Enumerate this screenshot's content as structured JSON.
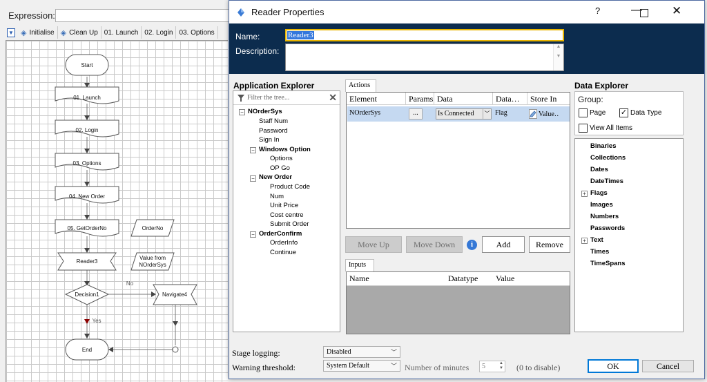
{
  "background": {
    "expression_label": "Expression:",
    "toolbar": {
      "items": [
        "Initialise",
        "Clean Up",
        "01. Launch",
        "02. Login",
        "03. Options"
      ]
    },
    "flow": {
      "start": "Start",
      "launch": "01. Launch",
      "login": "02. Login",
      "options": "03. Options",
      "new_order": "04. New Order",
      "get_order_no": "05. GetOrderNo",
      "order_no": "OrderNo",
      "reader": "Reader3",
      "value_from": "Value from",
      "value_from2": "NOrderSys",
      "decision": "Decision1",
      "no_label": "No",
      "yes_label": "Yes",
      "navigate": "Navigate4",
      "end": "End"
    }
  },
  "dialog": {
    "title": "Reader Properties",
    "controls": {
      "help": "?",
      "minimize": "—",
      "close": "✕"
    },
    "name_label": "Name:",
    "name_value": "Reader3",
    "description_label": "Description:",
    "description_value": "",
    "app_explorer": {
      "title": "Application Explorer",
      "filter_placeholder": "Filter the tree...",
      "tree": [
        {
          "label": "NOrderSys",
          "bold": true,
          "level": 0
        },
        {
          "label": "Staff Num",
          "bold": false,
          "level": 1
        },
        {
          "label": "Password",
          "bold": false,
          "level": 1
        },
        {
          "label": "Sign In",
          "bold": false,
          "level": 1
        },
        {
          "label": "Windows Option",
          "bold": true,
          "level": 1
        },
        {
          "label": "Options",
          "bold": false,
          "level": 2
        },
        {
          "label": "OP Go",
          "bold": false,
          "level": 2
        },
        {
          "label": "New Order",
          "bold": true,
          "level": 1
        },
        {
          "label": "Product Code",
          "bold": false,
          "level": 2
        },
        {
          "label": "Num",
          "bold": false,
          "level": 2
        },
        {
          "label": "Unit Price",
          "bold": false,
          "level": 2
        },
        {
          "label": "Cost centre",
          "bold": false,
          "level": 2
        },
        {
          "label": "Submit Order",
          "bold": false,
          "level": 2
        },
        {
          "label": "OrderConfirm",
          "bold": true,
          "level": 1
        },
        {
          "label": "OrderInfo",
          "bold": false,
          "level": 2
        },
        {
          "label": "Continue",
          "bold": false,
          "level": 2
        }
      ]
    },
    "actions": {
      "tab_label": "Actions",
      "columns": [
        "Element",
        "Params",
        "Data",
        "Data…",
        "Store In"
      ],
      "row": {
        "element": "NOrderSys",
        "params": "...",
        "data": "Is Connected",
        "datatype": "Flag",
        "store_in": "Value…"
      },
      "move_up": "Move Up",
      "move_down": "Move Down",
      "info": "i",
      "add": "Add",
      "remove": "Remove"
    },
    "inputs": {
      "tab_label": "Inputs",
      "columns": [
        "Name",
        "Datatype",
        "Value"
      ]
    },
    "data_explorer": {
      "title": "Data Explorer",
      "group_label": "Group:",
      "page_label": "Page",
      "page_checked": false,
      "datatype_label": "Data Type",
      "datatype_checked": true,
      "view_all_label": "View All Items",
      "view_all_checked": false,
      "items": [
        {
          "label": "Binaries",
          "expandable": false
        },
        {
          "label": "Collections",
          "expandable": false
        },
        {
          "label": "Dates",
          "expandable": false
        },
        {
          "label": "DateTimes",
          "expandable": false
        },
        {
          "label": "Flags",
          "expandable": true
        },
        {
          "label": "Images",
          "expandable": false
        },
        {
          "label": "Numbers",
          "expandable": false
        },
        {
          "label": "Passwords",
          "expandable": false
        },
        {
          "label": "Text",
          "expandable": true
        },
        {
          "label": "Times",
          "expandable": false
        },
        {
          "label": "TimeSpans",
          "expandable": false
        }
      ]
    },
    "stage_logging_label": "Stage logging:",
    "stage_logging_value": "Disabled",
    "warning_threshold_label": "Warning threshold:",
    "warning_threshold_value": "System Default",
    "minutes_label": "Number of minutes",
    "minutes_value": "5",
    "disable_hint": "(0 to disable)",
    "ok": "OK",
    "cancel": "Cancel"
  }
}
